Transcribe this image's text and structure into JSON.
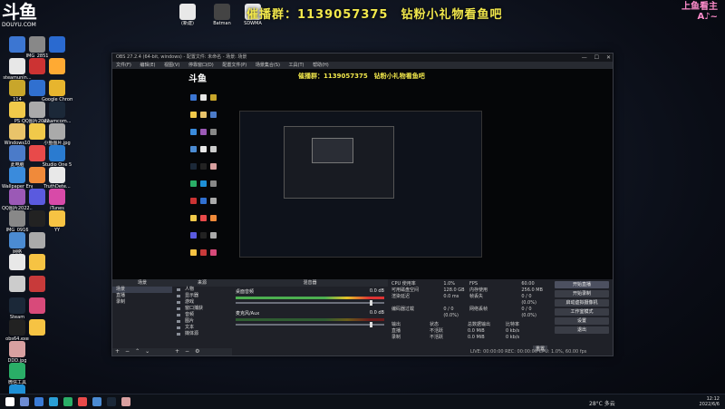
{
  "overlay": {
    "douyu_logo": "斗鱼",
    "douyu_domain": "DOUYU.COM",
    "banner": "催播群：1139057375　钻粉小礼物看鱼吧",
    "badge_top": "上鱼看主",
    "badge_bottom": "A♪~"
  },
  "desktop": {
    "icons": [
      {
        "label": "",
        "color": "#3c76d2"
      },
      {
        "label": "steamunin...",
        "color": "#e7e7e7"
      },
      {
        "label": "114",
        "color": "#c8a62b"
      },
      {
        "label": "PS",
        "color": "#f1c94a"
      },
      {
        "label": "Windows10",
        "color": "#e9c46a"
      },
      {
        "label": "此电脑",
        "color": "#4b7bc9"
      },
      {
        "label": "Wallpaper Engine",
        "color": "#3a8bdc"
      },
      {
        "label": "QQ图片2022...",
        "color": "#9b59b6"
      },
      {
        "label": "IMG_0916",
        "color": "#888888"
      },
      {
        "label": "网络",
        "color": "#4b8bd2"
      },
      {
        "label": "",
        "color": "#e8e8e8"
      },
      {
        "label": "",
        "color": "#cccccc"
      },
      {
        "label": "Steam",
        "color": "#1b2838"
      },
      {
        "label": "obs64.exe",
        "color": "#222222"
      },
      {
        "label": "DDD.jpg",
        "color": "#d8a0a0"
      },
      {
        "label": "微信工具",
        "color": "#2aae67"
      },
      {
        "label": "Microsoft Edge",
        "color": "#1e90d6"
      },
      {
        "label": "IMG_2851",
        "color": "#888888"
      },
      {
        "label": "",
        "color": "#cc3333"
      },
      {
        "label": "",
        "color": "#3070d0"
      },
      {
        "label": "QQ图片2022...",
        "color": "#aaaaaa"
      },
      {
        "label": "",
        "color": "#f1c94a"
      },
      {
        "label": "",
        "color": "#e84a4a"
      },
      {
        "label": "",
        "color": "#f08a3a"
      },
      {
        "label": "",
        "color": "#5a5adf"
      },
      {
        "label": "",
        "color": "#222222"
      },
      {
        "label": "",
        "color": "#aaaaaa"
      },
      {
        "label": "",
        "color": "#f6c343"
      },
      {
        "label": "",
        "color": "#c83a3a"
      },
      {
        "label": "",
        "color": "#d84a7a"
      },
      {
        "label": "",
        "color": "#f6c343"
      },
      {
        "label": "",
        "color": "#2a6ad0"
      },
      {
        "label": "",
        "color": "#ffaa33"
      },
      {
        "label": "Google Chrome",
        "color": "#e7b52e"
      },
      {
        "label": "steamcom...",
        "color": "#1b2838"
      },
      {
        "label": "小鱼图片.jpg",
        "color": "#aaaaaa"
      },
      {
        "label": "Studio One 5",
        "color": "#2a7bd0"
      },
      {
        "label": "TruthDete...",
        "color": "#e8e8e8"
      },
      {
        "label": "iTunes",
        "color": "#d84aa8"
      },
      {
        "label": "YY",
        "color": "#f6c343"
      },
      {
        "label": "(新建)",
        "color": "#e8e8e8"
      },
      {
        "label": "Batman",
        "color": "#444444"
      },
      {
        "label": "SDWMA",
        "color": "#e8e8e8"
      }
    ]
  },
  "obs": {
    "title": "OBS 27.2.4 (64-bit, windows) - 配置文件: 未命名 - 场景: 场景",
    "menu": [
      "文件(F)",
      "编辑(E)",
      "视图(V)",
      "停靠窗口(D)",
      "配置文件(P)",
      "场景集合(S)",
      "工具(T)",
      "帮助(H)"
    ],
    "window_buttons": [
      "—",
      "☐",
      "✕"
    ],
    "preview_label": "来源属性",
    "scenes": {
      "header": "场景",
      "items": [
        "场景",
        "直播",
        "录制"
      ]
    },
    "sources": {
      "header": "来源",
      "items": [
        "人物",
        "显示器",
        "游戏",
        "窗口捕获",
        "音频",
        "图片",
        "文本",
        "媒体源"
      ]
    },
    "mixer": {
      "header": "混音器",
      "channels": [
        {
          "name": "桌面音频",
          "level": "0.0 dB"
        },
        {
          "name": "麦克风/Aux",
          "level": "0.0 dB"
        }
      ]
    },
    "stats": {
      "rows": [
        {
          "k": "CPU 使用率",
          "v": "1.0%",
          "k2": "FPS",
          "v2": "60.00"
        },
        {
          "k": "可用磁盘空间",
          "v": "128.0 GB",
          "k2": "内存使用",
          "v2": "256.0 MB"
        },
        {
          "k": "渲染延迟",
          "v": "0.0 ms",
          "k2": "帧丢失",
          "v2": "0 / 0 (0.0%)"
        },
        {
          "k": "编码器过载",
          "v": "0 / 0 (0.0%)",
          "k2": "网络丢帧",
          "v2": "0 / 0 (0.0%)"
        }
      ],
      "table_head": [
        "输出",
        "状态",
        "总数据输出",
        "比特率"
      ],
      "table_rows": [
        [
          "直播",
          "不活跃",
          "0.0 MiB",
          "0 kb/s"
        ],
        [
          "录制",
          "不活跃",
          "0.0 MiB",
          "0 kb/s"
        ]
      ],
      "reset_button": "重置"
    },
    "controls": {
      "header": "控件",
      "buttons": [
        "开始直播",
        "开始录制",
        "启动虚拟摄像机",
        "工作室模式",
        "设置",
        "退出"
      ]
    },
    "status": "LIVE: 00:00:00   REC: 00:00:00   CPU: 1.0%, 60.00 fps"
  },
  "taskbar": {
    "weather": "28°C 多云",
    "time": "12:12",
    "date": "2022/6/6",
    "icon_colors": [
      "#ffffff",
      "#6d8cd4",
      "#3a7bd5",
      "#2a9fd6",
      "#2aae67",
      "#e84a4a",
      "#4b8bd2",
      "#1b2838",
      "#d8a0a0"
    ]
  }
}
